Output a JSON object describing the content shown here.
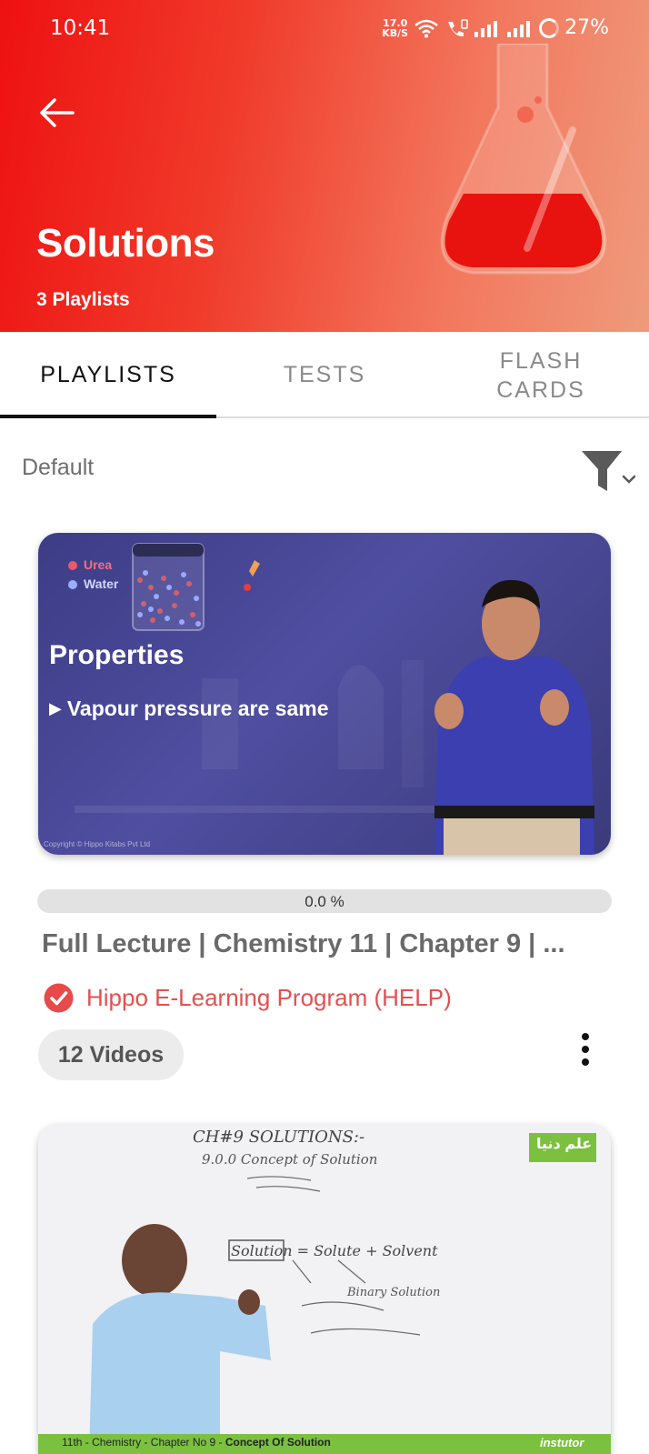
{
  "status_bar": {
    "time": "10:41",
    "net_speed_value": "17.0",
    "net_speed_unit": "KB/S",
    "battery": "27%"
  },
  "header": {
    "title": "Solutions",
    "subtitle": "3 Playlists",
    "back_icon": "back-arrow-icon",
    "decoration_icon": "flask-icon"
  },
  "tabs": [
    {
      "label": "PLAYLISTS",
      "active": true
    },
    {
      "label": "TESTS",
      "active": false
    },
    {
      "label": "FLASH\nCARDS",
      "active": false
    }
  ],
  "toolbar": {
    "sort_label": "Default",
    "filter_icon": "filter-icon"
  },
  "playlists": [
    {
      "thumbnail": {
        "legend_1": "Urea",
        "legend_2": "Water",
        "heading": "Properties",
        "bullet": "Vapour pressure are same",
        "copyright": "Copyright © Hippo Kitabs Pvt Ltd"
      },
      "progress_percent": 0.0,
      "progress_label": "0.0 %",
      "title": "Full Lecture | Chemistry 11 | Chapter 9 | ...",
      "channel": "Hippo E-Learning Program (HELP)",
      "video_count": "12 Videos"
    },
    {
      "thumbnail": {
        "board_line_1": "CH#9 SOLUTIONS:-",
        "board_line_2": "9.0.0 Concept of Solution",
        "board_line_3": "Solution = Solute + Solvent",
        "board_line_4": "Binary Solution",
        "logo_text": "علم دنیا",
        "footer_text": "11th - Chemistry - Chapter No 9 - ",
        "footer_bold": "Concept Of Solution",
        "footer_brand": "instutor"
      }
    }
  ],
  "colors": {
    "header_start": "#ee1111",
    "header_end": "#ef9a7c",
    "accent": "#e35050",
    "active_tab": "#111111",
    "inactive_tab": "#8a8a8a"
  }
}
